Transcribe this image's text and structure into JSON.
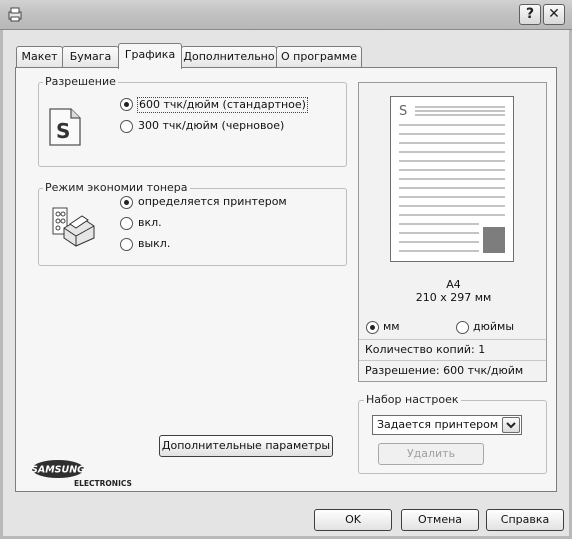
{
  "title_bar": {
    "help_glyph": "?",
    "close_glyph": "✕"
  },
  "tabs": [
    {
      "label": "Макет"
    },
    {
      "label": "Бумага"
    },
    {
      "label": "Графика"
    },
    {
      "label": "Дополнительно"
    },
    {
      "label": "О программе"
    }
  ],
  "resolution": {
    "legend": "Разрешение",
    "options": [
      {
        "label": "600 тчк/дюйм (стандартное)",
        "selected": true
      },
      {
        "label": "300 тчк/дюйм (черновое)",
        "selected": false
      }
    ]
  },
  "toner_save": {
    "legend": "Режим экономии тонера",
    "options": [
      {
        "label": "определяется принтером",
        "selected": true
      },
      {
        "label": "вкл.",
        "selected": false
      },
      {
        "label": "выкл.",
        "selected": false
      }
    ]
  },
  "preview": {
    "paper_name": "A4",
    "paper_size": "210 x 297 мм",
    "units": [
      {
        "label": "мм",
        "selected": true
      },
      {
        "label": "дюймы",
        "selected": false
      }
    ],
    "copies": "Количество копий: 1",
    "resolution": "Разрешение: 600 тчк/дюйм"
  },
  "presets": {
    "legend": "Набор настроек",
    "selected": "Задается принтером",
    "delete_label": "Удалить"
  },
  "advanced_button": "Дополнительные параметры",
  "brand": {
    "name": "SAMSUNG",
    "sub": "ELECTRONICS"
  },
  "dialog_buttons": {
    "ok": "OK",
    "cancel": "Отмена",
    "help": "Справка"
  },
  "colors": {
    "title_bar": "#c4c4c4",
    "panel": "#f6f6f6",
    "window": "#e4e4e4"
  }
}
